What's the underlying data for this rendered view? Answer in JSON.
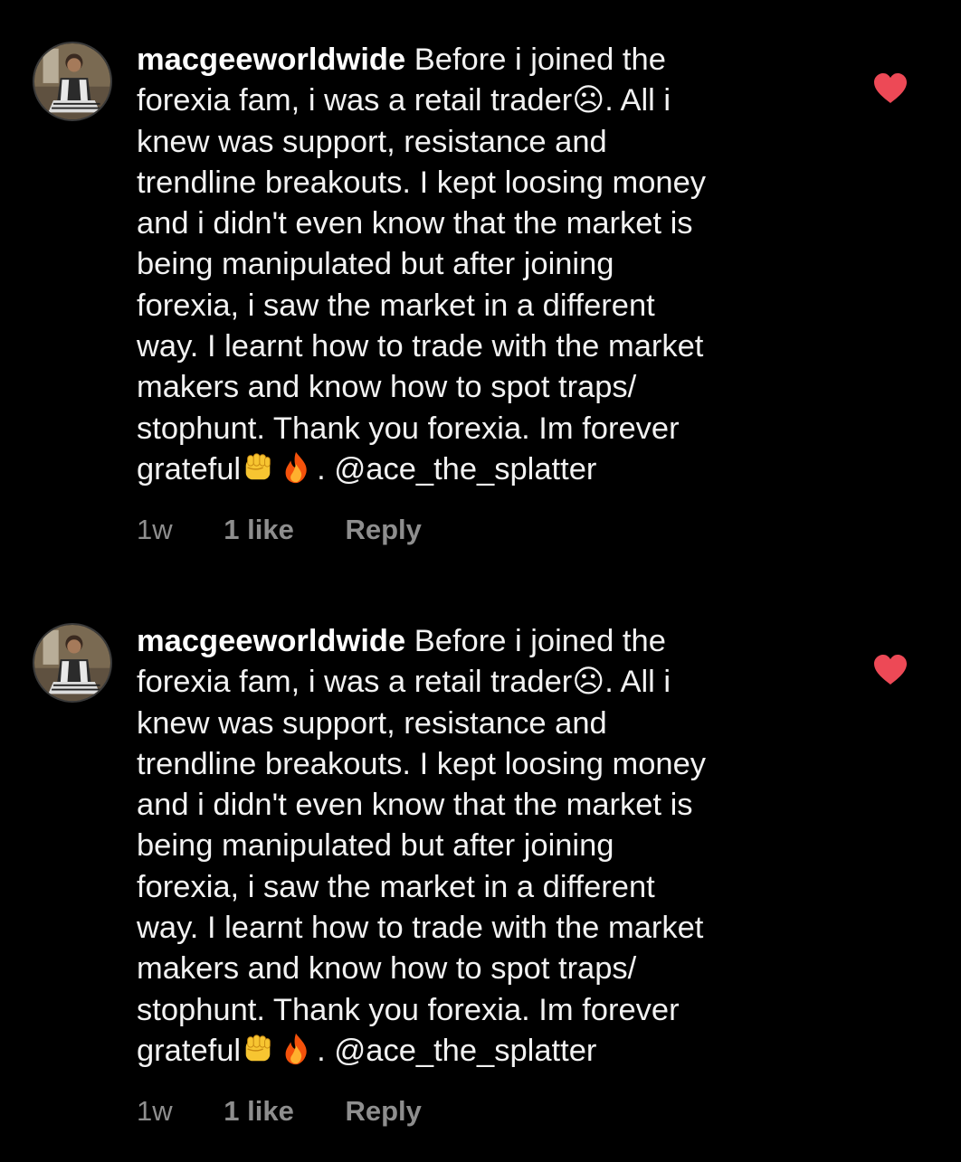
{
  "comments": [
    {
      "username": "macgeeworldwide",
      "lines": [
        " Before i joined the",
        "forexia fam, i was a retail trader☹. All i",
        "knew was support, resistance and",
        "trendline breakouts. I kept loosing money",
        "and i didn't even know that the market is",
        "being manipulated  but after joining",
        "forexia, i saw the market in a different",
        "way. I learnt how to trade with the market",
        "makers and know how to spot traps/",
        "stophunt. Thank you forexia. Im forever"
      ],
      "last_line_prefix": "grateful",
      "last_line_suffix": ". @ace_the_splatter",
      "emojis": [
        "raised-fist-emoji",
        "fire-emoji"
      ],
      "time": "1w",
      "likes": "1 like",
      "reply": "Reply",
      "liked": true
    },
    {
      "username": "macgeeworldwide",
      "lines": [
        " Before i joined the",
        "forexia fam, i was a retail trader☹. All i",
        "knew was support, resistance and",
        "trendline breakouts. I kept loosing money",
        "and i didn't even know that the market is",
        "being manipulated  but after joining",
        "forexia, i saw the market in a different",
        "way. I learnt how to trade with the market",
        "makers and know how to spot traps/",
        "stophunt. Thank you forexia. Im forever"
      ],
      "last_line_prefix": "grateful",
      "last_line_suffix": ". @ace_the_splatter",
      "emojis": [
        "raised-fist-emoji",
        "fire-emoji"
      ],
      "time": "1w",
      "likes": "1 like",
      "reply": "Reply",
      "liked": true
    }
  ],
  "colors": {
    "background": "#000000",
    "text": "#f2f2f2",
    "meta": "#8e8e8e",
    "heart": "#ed4956"
  }
}
